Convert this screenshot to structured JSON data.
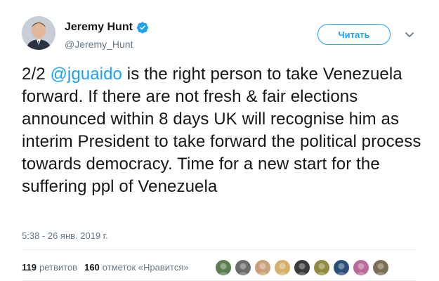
{
  "author": {
    "display_name": "Jeremy Hunt",
    "handle": "@Jeremy_Hunt",
    "verified": true,
    "avatar_icon": "avatar-photo"
  },
  "follow_button": {
    "label": "Читать"
  },
  "menu_icon": "chevron-down-icon",
  "tweet": {
    "prefix": "2/2 ",
    "mention": "@jguaido",
    "body": " is the right person to take Venezuela forward. If there are not fresh & fair elections announced within 8 days UK will recognise him as interim President to take forward the political process towards democracy. Time for a new start for the suffering ppl of Venezuela"
  },
  "timestamp": "5:38 - 26 янв. 2019 г.",
  "stats": {
    "retweets_count": "119",
    "retweets_label": "ретвитов",
    "likes_count": "160",
    "likes_label": "отметок «Нравится»"
  },
  "likers": [
    {
      "color": "#5a7d4f"
    },
    {
      "color": "#6b6b6b"
    },
    {
      "color": "#c9a07a"
    },
    {
      "color": "#d4b06a"
    },
    {
      "color": "#3a3a3a"
    },
    {
      "color": "#8f8a3e"
    },
    {
      "color": "#2c4f7a"
    },
    {
      "color": "#b96a9a"
    },
    {
      "color": "#7a6f52"
    }
  ],
  "colors": {
    "accent": "#1da1f2",
    "text": "#14171a",
    "muted": "#657786",
    "divider": "#e6ecf0"
  }
}
